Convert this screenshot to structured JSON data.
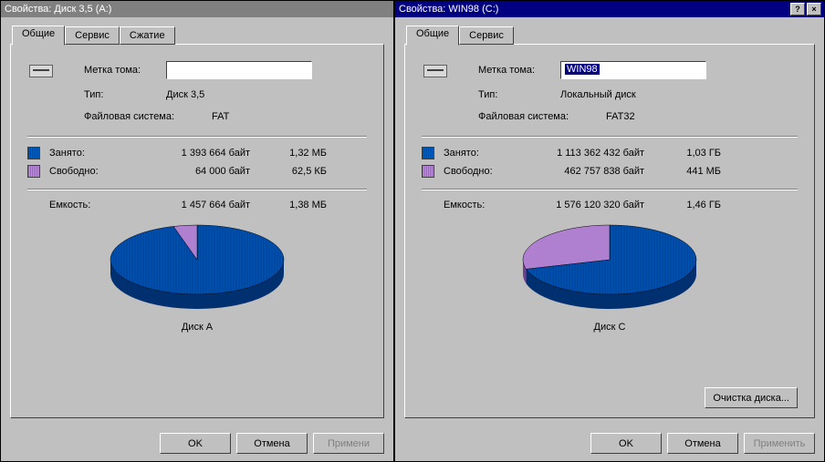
{
  "left": {
    "title": "Свойства: Диск 3,5 (A:)",
    "tabs": [
      "Общие",
      "Сервис",
      "Сжатие"
    ],
    "active_tab": 0,
    "volume_label_caption": "Метка тома:",
    "volume_label_value": "",
    "type_caption": "Тип:",
    "type_value": "Диск 3,5",
    "fs_caption": "Файловая система:",
    "fs_value": "FAT",
    "used_caption": "Занято:",
    "used_bytes": "1 393 664 байт",
    "used_human": "1,32 МБ",
    "free_caption": "Свободно:",
    "free_bytes": "64 000 байт",
    "free_human": "62,5 КБ",
    "capacity_caption": "Емкость:",
    "capacity_bytes": "1 457 664 байт",
    "capacity_human": "1,38 МБ",
    "pie_caption": "Диск A",
    "buttons": {
      "ok": "OK",
      "cancel": "Отмена",
      "apply": "Примени"
    }
  },
  "right": {
    "title": "Свойства: WIN98 (C:)",
    "tabs": [
      "Общие",
      "Сервис"
    ],
    "active_tab": 0,
    "volume_label_caption": "Метка тома:",
    "volume_label_value": "WIN98",
    "type_caption": "Тип:",
    "type_value": "Локальный диск",
    "fs_caption": "Файловая система:",
    "fs_value": "FAT32",
    "used_caption": "Занято:",
    "used_bytes": "1 113 362 432 байт",
    "used_human": "1,03 ГБ",
    "free_caption": "Свободно:",
    "free_bytes": "462 757 838 байт",
    "free_human": "441 МБ",
    "capacity_caption": "Емкость:",
    "capacity_bytes": "1 576 120 320 байт",
    "capacity_human": "1,46 ГБ",
    "pie_caption": "Диск C",
    "cleanup_button": "Очистка диска...",
    "buttons": {
      "ok": "OK",
      "cancel": "Отмена",
      "apply": "Применить"
    }
  },
  "colors": {
    "used": "#0050b0",
    "used_side": "#003070",
    "free": "#b080d0",
    "free_side": "#704090"
  },
  "chart_data": [
    {
      "type": "pie",
      "title": "Диск A",
      "series": [
        {
          "name": "Занято",
          "value": 1393664,
          "color": "#0050b0"
        },
        {
          "name": "Свободно",
          "value": 64000,
          "color": "#b080d0"
        }
      ]
    },
    {
      "type": "pie",
      "title": "Диск C",
      "series": [
        {
          "name": "Занято",
          "value": 1113362432,
          "color": "#0050b0"
        },
        {
          "name": "Свободно",
          "value": 462757838,
          "color": "#b080d0"
        }
      ]
    }
  ]
}
